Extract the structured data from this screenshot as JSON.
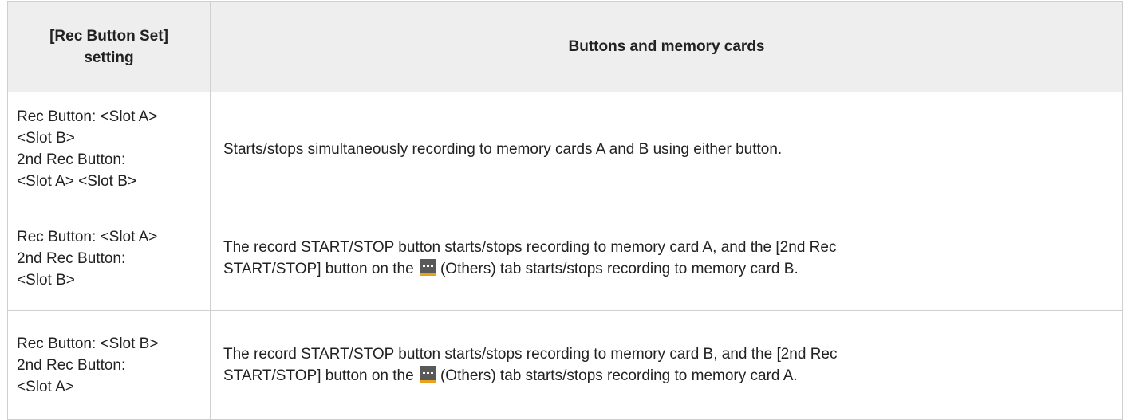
{
  "table": {
    "headers": {
      "setting_line1": "[Rec Button Set]",
      "setting_line2": "setting",
      "description": "Buttons and memory cards"
    },
    "icons": {
      "others_tab": "others-tab-icon",
      "others_tab_colors": {
        "background": "#595959",
        "underline": "#e8a21b"
      }
    },
    "rows": [
      {
        "setting_lines": [
          "Rec Button: <Slot A>",
          "<Slot B>",
          "2nd Rec Button:",
          "<Slot A> <Slot B>"
        ],
        "description": "Starts/stops simultaneously recording to memory cards A and B using either button."
      },
      {
        "setting_lines": [
          "Rec Button: <Slot A>",
          "2nd Rec Button:",
          "<Slot B>"
        ],
        "description_line1": "The record START/STOP button starts/stops recording to memory card A, and the [2nd Rec",
        "description_line2_before_icon": "START/STOP] button on the",
        "description_line2_after_icon": "(Others) tab starts/stops recording to memory card B."
      },
      {
        "setting_lines": [
          "Rec Button: <Slot B>",
          "2nd Rec Button:",
          "<Slot A>"
        ],
        "description_line1": "The record START/STOP button starts/stops recording to memory card B, and the [2nd Rec",
        "description_line2_before_icon": "START/STOP] button on the",
        "description_line2_after_icon": "(Others) tab starts/stops recording to memory card A."
      }
    ]
  }
}
